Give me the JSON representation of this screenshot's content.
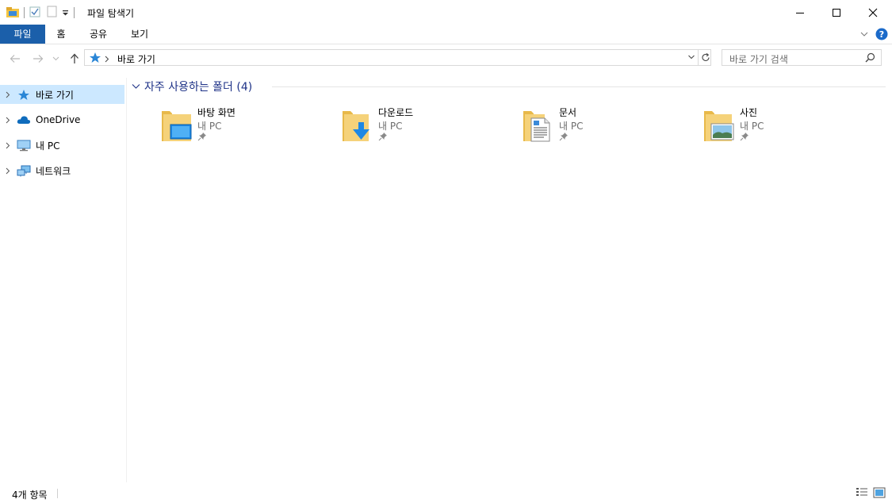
{
  "window": {
    "title": "파일 탐색기"
  },
  "ribbon": {
    "tabs": [
      "파일",
      "홈",
      "공유",
      "보기"
    ]
  },
  "address": {
    "path": "바로 가기"
  },
  "search": {
    "placeholder": "바로 가기 검색"
  },
  "sidebar": {
    "items": [
      {
        "label": "바로 가기",
        "icon": "star-icon",
        "selected": true
      },
      {
        "label": "OneDrive",
        "icon": "cloud-icon",
        "selected": false
      },
      {
        "label": "내 PC",
        "icon": "monitor-icon",
        "selected": false
      },
      {
        "label": "네트워크",
        "icon": "network-icon",
        "selected": false
      }
    ]
  },
  "group": {
    "title": "자주 사용하는 폴더 (4)"
  },
  "folders": [
    {
      "name": "바탕 화면",
      "location": "내 PC",
      "icon": "desktop-folder-icon"
    },
    {
      "name": "다운로드",
      "location": "내 PC",
      "icon": "download-folder-icon"
    },
    {
      "name": "문서",
      "location": "내 PC",
      "icon": "documents-folder-icon"
    },
    {
      "name": "사진",
      "location": "내 PC",
      "icon": "pictures-folder-icon"
    }
  ],
  "status": {
    "item_count": "4개 항목"
  },
  "colors": {
    "accent": "#1b5faa",
    "selection": "#cce8ff",
    "folder": "#f5d27a",
    "group_heading": "#1e3287"
  }
}
